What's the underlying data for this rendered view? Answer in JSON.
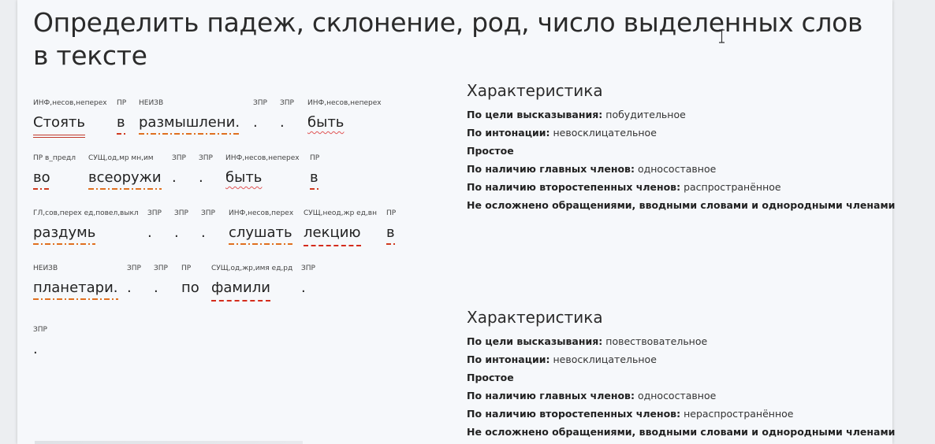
{
  "title": "Определить падеж, склонение, род, число выделенных слов в тексте",
  "sentence1": {
    "row1": [
      {
        "tag": "ИНФ,несов,неперех",
        "word": "Стоять"
      },
      {
        "tag": "ПР",
        "word": "в"
      },
      {
        "tag": "НЕИЗВ",
        "word": "размышлени."
      },
      {
        "tag": "ЗПР",
        "word": "."
      },
      {
        "tag": "ЗПР",
        "word": "."
      },
      {
        "tag": "ИНФ,несов,неперех",
        "word": "быть"
      }
    ],
    "row2": [
      {
        "tag": "ПР в_предл",
        "word": "во"
      },
      {
        "tag": "СУЩ,од,мр мн,им",
        "word": "всеоружи"
      },
      {
        "tag": "ЗПР",
        "word": "."
      },
      {
        "tag": "ЗПР",
        "word": "."
      },
      {
        "tag": "ИНФ,несов,неперех",
        "word": "быть"
      },
      {
        "tag": "ПР",
        "word": "в"
      }
    ],
    "row3": [
      {
        "tag": "ГЛ,сов,перех ед,повел,выкл",
        "word": "раздумь"
      },
      {
        "tag": "ЗПР",
        "word": "."
      },
      {
        "tag": "ЗПР",
        "word": "."
      },
      {
        "tag": "ЗПР",
        "word": "."
      },
      {
        "tag": "ИНФ,несов,перех",
        "word": "слушать"
      },
      {
        "tag": "СУЩ,неод,жр ед,вн",
        "word": "лекцию"
      },
      {
        "tag": "ПР",
        "word": "в"
      }
    ],
    "row4": [
      {
        "tag": "НЕИЗВ",
        "word": "планетари."
      },
      {
        "tag": "ЗПР",
        "word": "."
      },
      {
        "tag": "ЗПР",
        "word": "."
      },
      {
        "tag": "ПР",
        "word": "по"
      },
      {
        "tag": "СУЩ,од,жр,имя ед,рд",
        "word": "фамили"
      },
      {
        "tag": "ЗПР",
        "word": "."
      }
    ]
  },
  "sentence2": {
    "row1": [
      {
        "tag": "ЗПР",
        "word": "."
      }
    ]
  },
  "characteristics": [
    {
      "heading": "Характеристика",
      "purpose_label": "По цели высказывания:",
      "purpose_value": "побудительное",
      "intonation_label": "По интонации:",
      "intonation_value": "невосклицательное",
      "simple": "Простое",
      "main_label": "По наличию главных членов:",
      "main_value": "односоставное",
      "secondary_label": "По наличию второстепенных членов:",
      "secondary_value": "распространённое",
      "complication": "Не осложнено обращениями, вводными словами и однородными членами"
    },
    {
      "heading": "Характеристика",
      "purpose_label": "По цели высказывания:",
      "purpose_value": "повествовательное",
      "intonation_label": "По интонации:",
      "intonation_value": "невосклицательное",
      "simple": "Простое",
      "main_label": "По наличию главных членов:",
      "main_value": "односоставное",
      "secondary_label": "По наличию второстепенных членов:",
      "secondary_value": "нераспространённое",
      "complication": "Не осложнено обращениями, вводными словами и однородными членами"
    }
  ],
  "colors": {
    "underline_red": "#c0392b",
    "underline_orange": "#e07020",
    "page_bg": "#f6f8fb"
  },
  "icons": {
    "cursor": "text-cursor-icon"
  }
}
